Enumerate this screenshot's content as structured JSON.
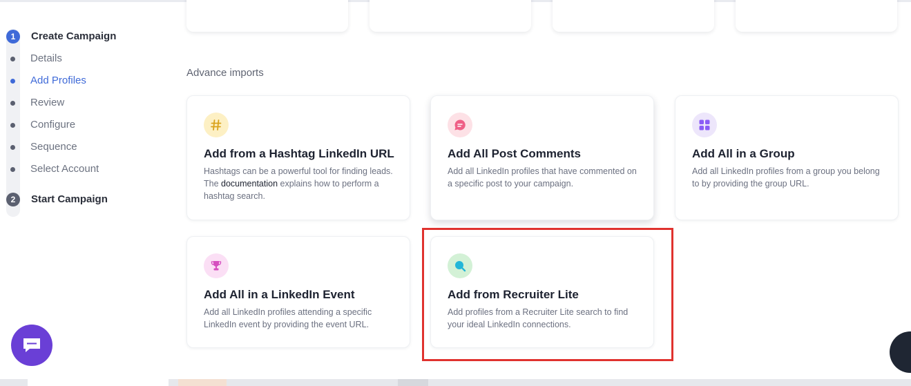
{
  "sidebar": {
    "steps": [
      {
        "number": "1",
        "label": "Create Campaign",
        "color": "#3f6ad8"
      },
      {
        "number": "2",
        "label": "Start Campaign",
        "color": "#5b6070"
      }
    ],
    "substeps": [
      {
        "label": "Details",
        "active": false
      },
      {
        "label": "Add Profiles",
        "active": true
      },
      {
        "label": "Review",
        "active": false
      },
      {
        "label": "Configure",
        "active": false
      },
      {
        "label": "Sequence",
        "active": false
      },
      {
        "label": "Select Account",
        "active": false
      }
    ]
  },
  "section": {
    "title": "Advance imports"
  },
  "cards": [
    {
      "icon": "hashtag-icon",
      "title": "Add from a Hashtag LinkedIn URL",
      "desc_before": "Hashtags can be a powerful tool for finding leads. The ",
      "desc_link": "documentation",
      "desc_after": " explains how to perform a hashtag search."
    },
    {
      "icon": "comment-icon",
      "title": "Add All Post Comments",
      "desc": "Add all LinkedIn profiles that have commented on a specific post to your campaign."
    },
    {
      "icon": "group-grid-icon",
      "title": "Add All in a Group",
      "desc": "Add all LinkedIn profiles from a group you belong to by providing the group URL."
    },
    {
      "icon": "trophy-icon",
      "title": "Add All in a LinkedIn Event",
      "desc": "Add all LinkedIn profiles attending a specific LinkedIn event by providing the event URL."
    },
    {
      "icon": "search-icon",
      "title": "Add from Recruiter Lite",
      "desc": "Add profiles from a Recruiter Lite search to find your ideal LinkedIn connections."
    }
  ],
  "colors": {
    "accent": "#3f6ad8",
    "highlight": "#e0322e",
    "chat": "#6a3fd6"
  }
}
